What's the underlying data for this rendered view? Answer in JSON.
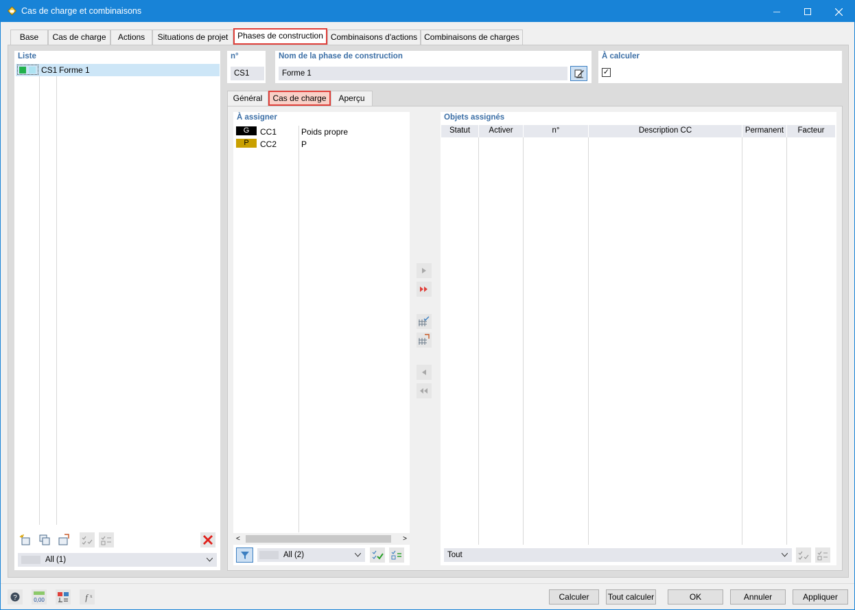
{
  "window": {
    "title": "Cas de charge et combinaisons"
  },
  "tabs": [
    {
      "label": "Base"
    },
    {
      "label": "Cas de charge"
    },
    {
      "label": "Actions"
    },
    {
      "label": "Situations de projet"
    },
    {
      "label": "Phases de construction",
      "active": true
    },
    {
      "label": "Combinaisons d'actions"
    },
    {
      "label": "Combinaisons de charges"
    }
  ],
  "list": {
    "header": "Liste",
    "items": [
      {
        "id": "CS1",
        "name": "Forme 1"
      }
    ],
    "filter": "All (1)"
  },
  "phase": {
    "no_label": "n°",
    "no_value": "CS1",
    "name_label": "Nom de la phase de construction",
    "name_value": "Forme 1",
    "calc_label": "À calculer",
    "calc_checked": "✓"
  },
  "subtabs": [
    {
      "label": "Général"
    },
    {
      "label": "Cas de charge",
      "active": true
    },
    {
      "label": "Aperçu"
    }
  ],
  "to_assign": {
    "header": "À assigner",
    "rows": [
      {
        "badge": "G",
        "badge_color": "#000000",
        "badge_text_color": "#ffffff",
        "code": "CC1",
        "desc": "Poids propre"
      },
      {
        "badge": "P",
        "badge_color": "#c9a000",
        "badge_text_color": "#000000",
        "code": "CC2",
        "desc": "P"
      }
    ],
    "filter": "All (2)"
  },
  "assigned": {
    "header": "Objets assignés",
    "columns": [
      "Statut",
      "Activer",
      "n°",
      "Description CC",
      "Permanent",
      "Facteur"
    ],
    "filter": "Tout"
  },
  "footer": {
    "calc": "Calculer",
    "calc_all": "Tout calculer",
    "ok": "OK",
    "cancel": "Annuler",
    "apply": "Appliquer"
  },
  "colors": {
    "titlebar": "#1883d7",
    "accent_label": "#3c6fa6",
    "highlight": "#e0403a"
  }
}
